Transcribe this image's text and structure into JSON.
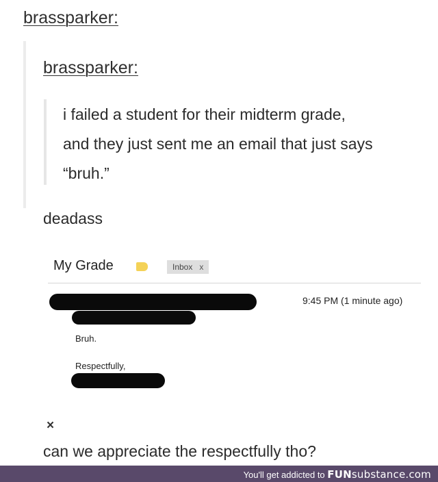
{
  "post": {
    "username_outer": "brassparker:",
    "username_inner": "brassparker:",
    "quote_lines": [
      "i failed a student for their midterm grade,",
      "and they just sent me an email that just says",
      "“bruh.”"
    ],
    "reply": "deadass",
    "comment": "can we appreciate the respectfully tho?",
    "close_symbol": "×"
  },
  "email": {
    "subject": "My Grade",
    "label_color": "#f4d257",
    "inbox_chip": "Inbox",
    "inbox_chip_close": "x",
    "timestamp": "9:45 PM (1 minute ago)",
    "body_line1": "Bruh.",
    "body_line2": "Respectfully,"
  },
  "footer": {
    "tagline": "You'll get addicted to ",
    "brand_bold": "FUN",
    "brand_rest": "substance.com",
    "background": "#59496a"
  },
  "icons": {
    "label": "label-tag-icon",
    "close": "close-icon"
  }
}
